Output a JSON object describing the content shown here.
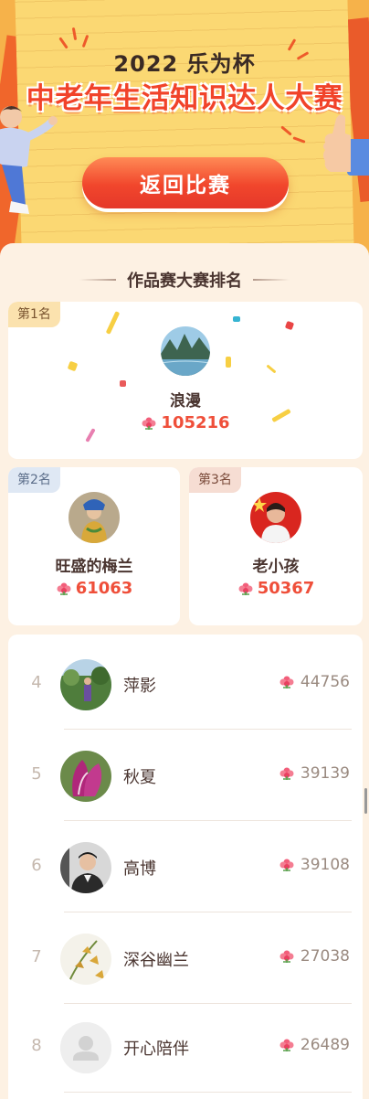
{
  "banner": {
    "year_title": "2022 乐为杯",
    "main_title": "中老年生活知识达人大赛",
    "back_button_label": "返回比赛"
  },
  "section": {
    "title": "作品赛大赛排名"
  },
  "podium": [
    {
      "badge": "第1名",
      "name": "浪漫",
      "score": "105216",
      "avatar_icon": "landscape-photo"
    },
    {
      "badge": "第2名",
      "name": "旺盛的梅兰",
      "score": "61063",
      "avatar_icon": "person-photo"
    },
    {
      "badge": "第3名",
      "name": "老小孩",
      "score": "50367",
      "avatar_icon": "person-photo"
    }
  ],
  "ranking_list": [
    {
      "rank": "4",
      "name": "萍影",
      "score": "44756",
      "avatar_icon": "person-photo"
    },
    {
      "rank": "5",
      "name": "秋夏",
      "score": "39139",
      "avatar_icon": "flower-photo"
    },
    {
      "rank": "6",
      "name": "高博",
      "score": "39108",
      "avatar_icon": "person-photo"
    },
    {
      "rank": "7",
      "name": "深谷幽兰",
      "score": "27038",
      "avatar_icon": "orchid-photo"
    },
    {
      "rank": "8",
      "name": "开心陪伴",
      "score": "26489",
      "avatar_icon": "default-avatar"
    }
  ],
  "flower_icon": "flower-icon",
  "colors": {
    "accent_red": "#f1432a",
    "score_red": "#ef4f3a",
    "background": "#fdf1e3",
    "banner_yellow": "#fbd873"
  }
}
